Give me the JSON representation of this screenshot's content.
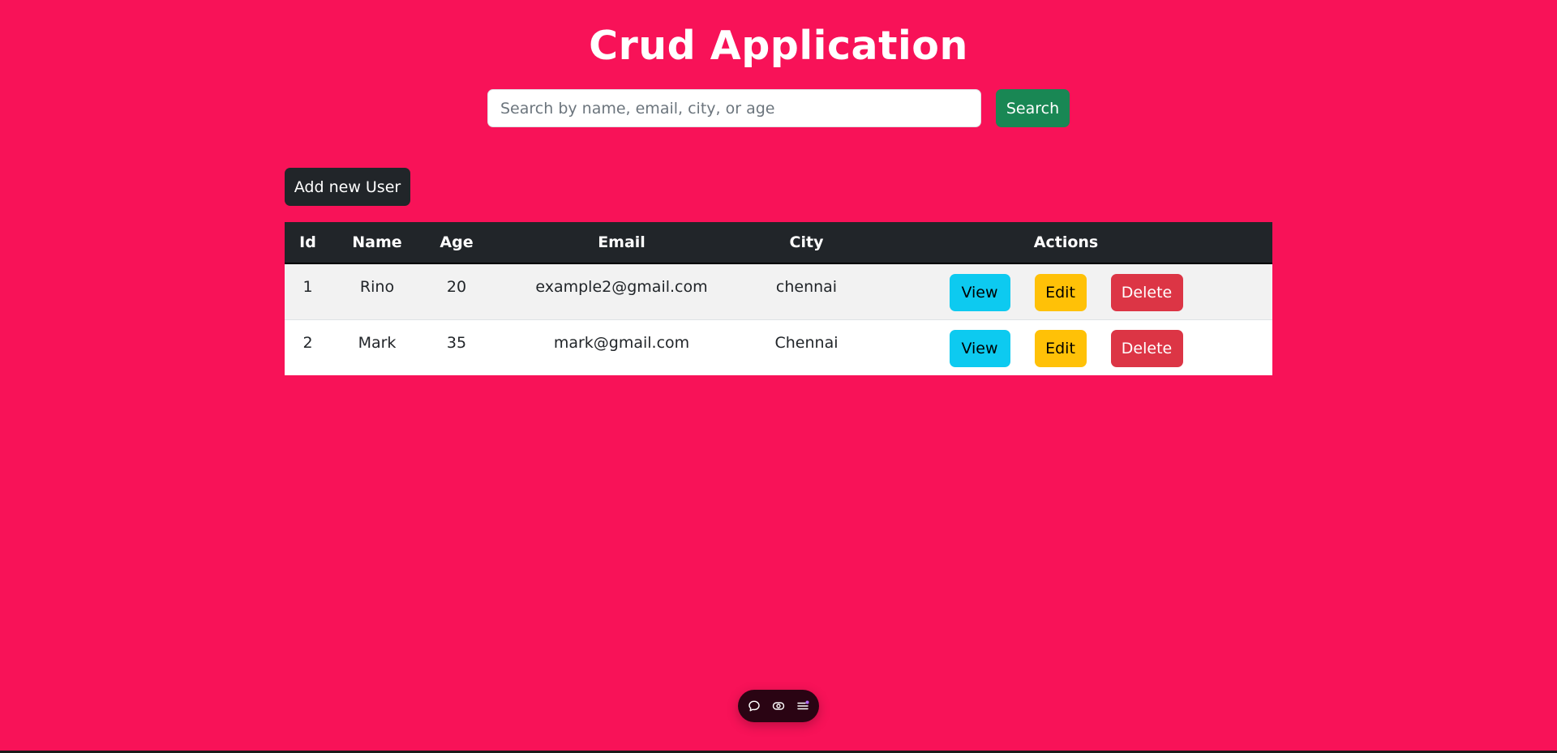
{
  "header": {
    "title": "Crud Application"
  },
  "search": {
    "placeholder": "Search by name, email, city, or age",
    "value": "",
    "button_label": "Search"
  },
  "toolbar": {
    "add_user_label": "Add new User"
  },
  "table": {
    "columns": [
      "Id",
      "Name",
      "Age",
      "Email",
      "City",
      "Actions"
    ],
    "rows": [
      {
        "id": "1",
        "name": "Rino",
        "age": "20",
        "email": "example2@gmail.com",
        "city": "chennai"
      },
      {
        "id": "2",
        "name": "Mark",
        "age": "35",
        "email": "mark@gmail.com",
        "city": "Chennai"
      }
    ],
    "actions": {
      "view_label": "View",
      "edit_label": "Edit",
      "delete_label": "Delete"
    }
  },
  "floating_toolbar": {
    "icons": [
      "chat-bubble-icon",
      "eye-icon",
      "menu-list-icon"
    ]
  },
  "colors": {
    "background": "#f81258",
    "view": "#0dcaf0",
    "edit": "#ffc107",
    "delete": "#dc3545",
    "search": "#198754",
    "dark": "#212529"
  }
}
